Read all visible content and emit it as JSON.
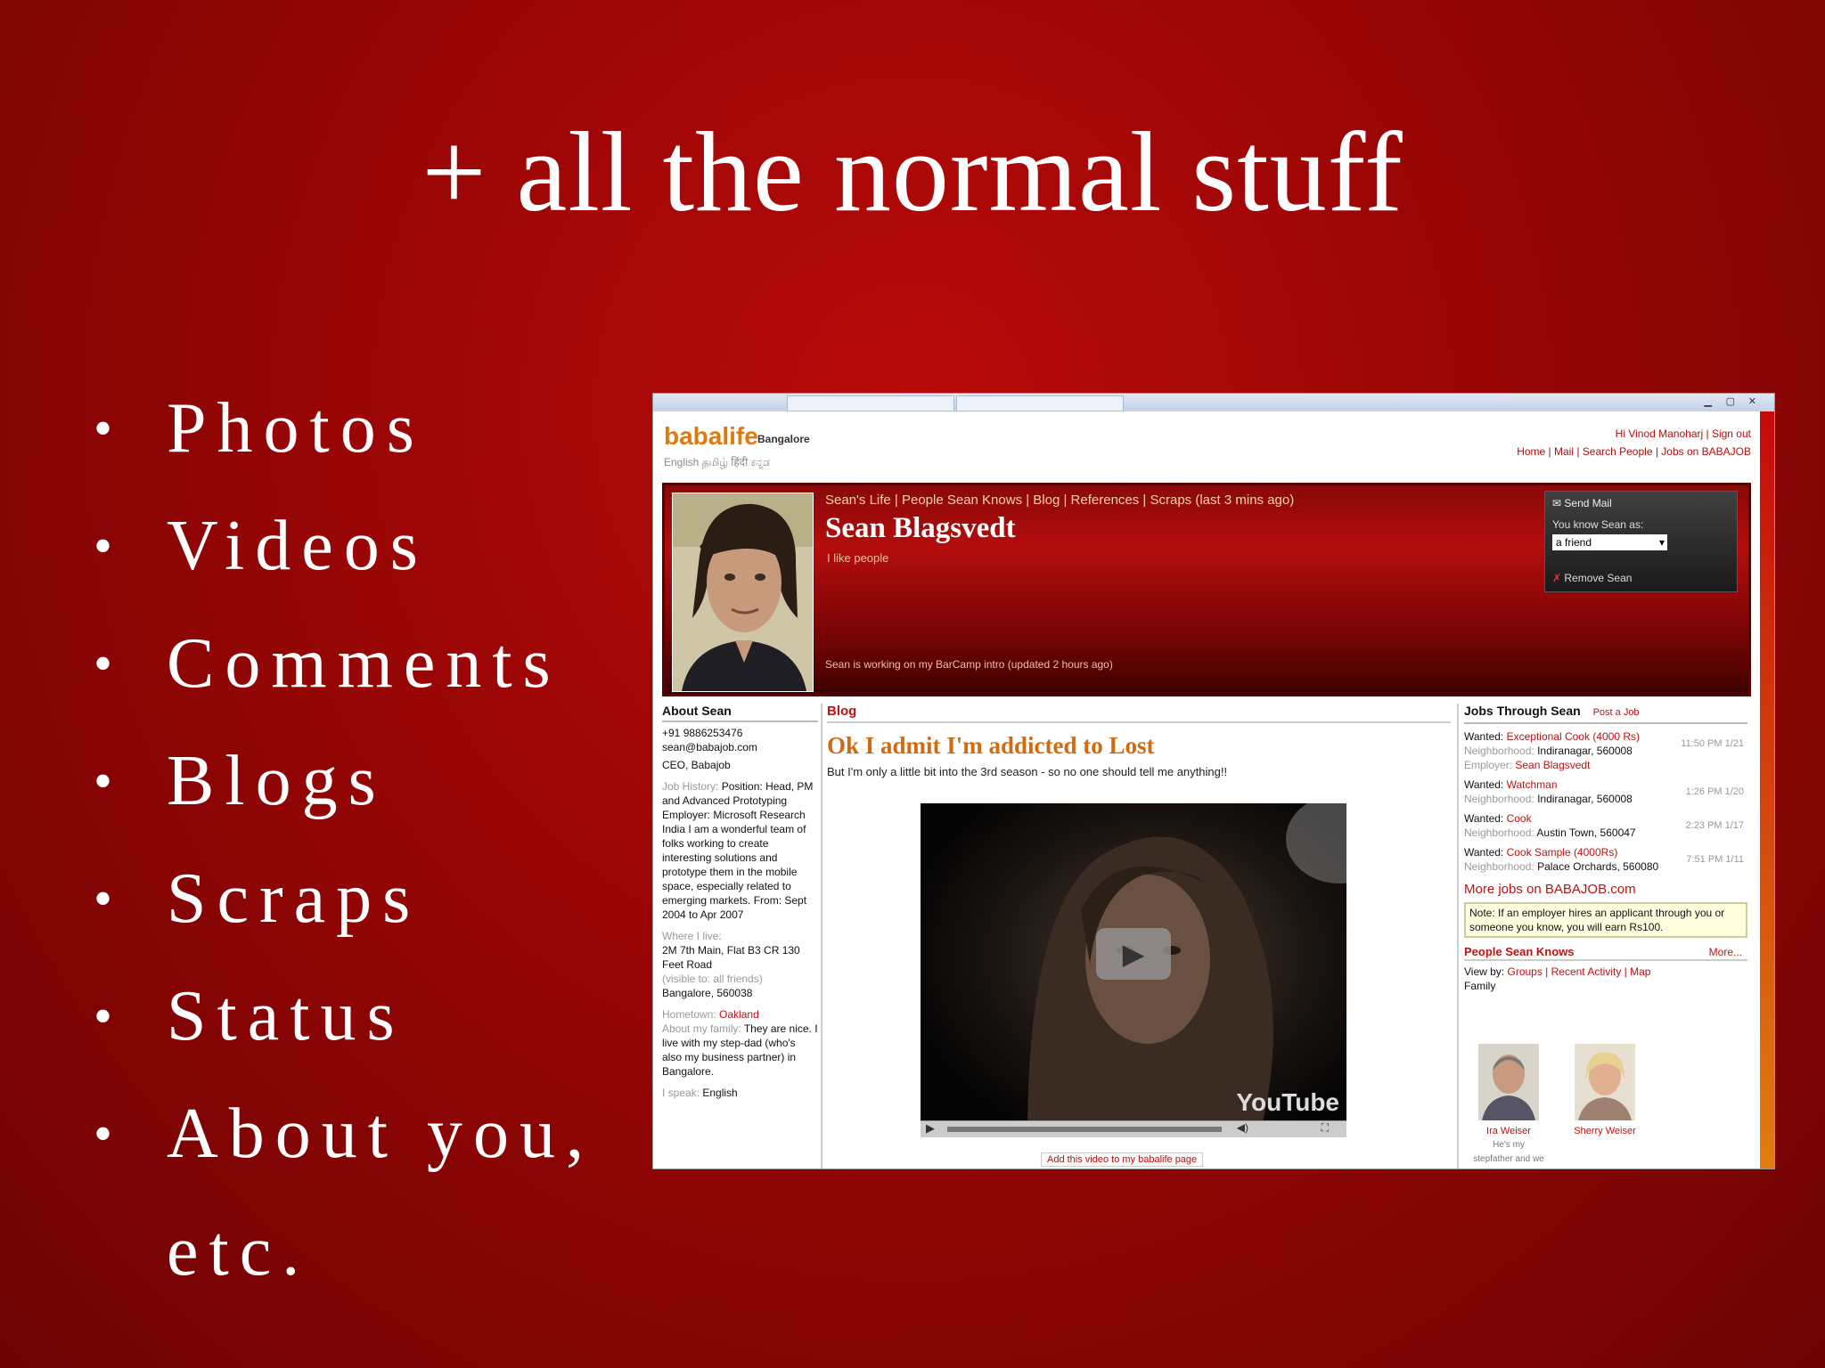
{
  "slide": {
    "title": "+ all the normal stuff",
    "bullets": [
      "Photos",
      "Videos",
      "Comments",
      "Blogs",
      "Scraps",
      "Status",
      "About you, etc."
    ],
    "bullet_symbol": "•"
  },
  "screenshot": {
    "site": {
      "logo": "babalife",
      "logo_sub": "English தமிழ் हिंदी ಕನ್ನಡ",
      "city": "Bangalore",
      "top_right_line1": "Hi Vinod Manoharj | Sign out",
      "top_right_line2": "Home | Mail | Search People | Jobs on BABAJOB"
    },
    "profile": {
      "nav": "Sean's Life | People Sean Knows | Blog | References | Scraps (last 3 mins ago)",
      "name": "Sean Blagsvedt",
      "tagline": "I like people",
      "status": "Sean is working on my BarCamp intro (updated 2 hours ago)",
      "send_mail": "Send Mail",
      "know_label": "You know Sean as:",
      "relation_value": "a friend",
      "remove": "Remove Sean"
    },
    "about": {
      "heading": "About Sean",
      "phone": "+91 9886253476",
      "email": "sean@babajob.com",
      "role": "CEO, Babajob",
      "job_history_label": "Job History:",
      "job_history": "Position: Head, PM and Advanced Prototyping Employer: Microsoft Research India I am a wonderful team of folks working to create interesting solutions and prototype them in the mobile space, especially related to emerging markets. From: Sept 2004 to Apr 2007",
      "where_label": "Where I live:",
      "address": "2M 7th Main, Flat B3 CR 130 Feet Road",
      "address_note": "(visible to: all friends)",
      "city": "Bangalore, 560038",
      "hometown_label": "Hometown:",
      "hometown": "Oakland",
      "family_label": "About my family:",
      "family": "They are nice. I live with my step-dad (who's also my business partner) in Bangalore.",
      "speak_label": "I speak:",
      "speak": "English"
    },
    "blog": {
      "heading": "Blog",
      "post_title": "Ok I admit I'm addicted to Lost",
      "post_sub": "But I'm only a little bit into the 3rd season - so no one should tell me anything!!",
      "video_logo": "YouTube",
      "video_link": "Add this video to my babalife page"
    },
    "jobs": {
      "heading": "Jobs Through Sean",
      "heading_link": "Post a Job",
      "items": [
        {
          "wanted_label": "Wanted:",
          "title": "Exceptional Cook (4000 Rs)",
          "nbhd_label": "Neighborhood:",
          "place": "Indiranagar, 560008",
          "employer_label": "Employer:",
          "employer": "Sean Blagsvedt",
          "time": "11:50 PM 1/21"
        },
        {
          "wanted_label": "Wanted:",
          "title": "Watchman",
          "nbhd_label": "Neighborhood:",
          "place": "Indiranagar, 560008",
          "time": "1:26 PM 1/20"
        },
        {
          "wanted_label": "Wanted:",
          "title": "Cook",
          "nbhd_label": "Neighborhood:",
          "place": "Austin Town, 560047",
          "time": "2:23 PM 1/17"
        },
        {
          "wanted_label": "Wanted:",
          "title": "Cook Sample (4000Rs)",
          "nbhd_label": "Neighborhood:",
          "place": "Palace Orchards, 560080",
          "time": "7:51 PM 1/11"
        }
      ],
      "more": "More jobs on BABAJOB.com",
      "note": "Note: If an employer hires an applicant through you or someone you know, you will earn Rs100."
    },
    "people": {
      "heading": "People Sean Knows",
      "more": "More...",
      "viewby_label": "View by:",
      "viewby_opts": "Groups | Recent Activity | Map",
      "group": "Family",
      "persons": [
        {
          "name": "Ira Weiser",
          "note": "He's my stepfather and we work"
        },
        {
          "name": "Sherry Weiser"
        }
      ]
    }
  }
}
